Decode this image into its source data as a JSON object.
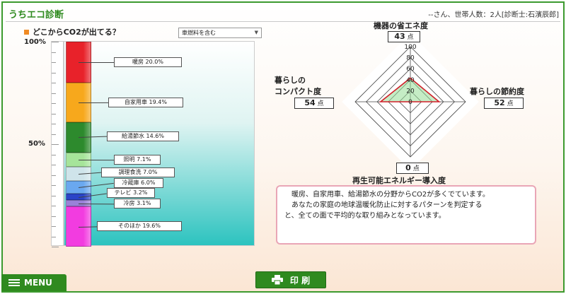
{
  "app": {
    "title": "うちエコ診断",
    "user_info": "--さん、世帯人数：2人[診断士:石濱辰郎]"
  },
  "co2_section": {
    "title": "どこからCO2が出てる？",
    "select_value": "車燃料を含む",
    "axis_labels": [
      "100%",
      "50%"
    ]
  },
  "chart_data": [
    {
      "type": "bar",
      "stacked": true,
      "title": "どこからCO2が出てる？",
      "categories": [
        "暖房",
        "自家用車",
        "給湯節水",
        "照明",
        "調理食洗",
        "冷蔵庫",
        "テレビ",
        "冷房",
        "そのほか"
      ],
      "values": [
        20.0,
        19.4,
        14.6,
        7.1,
        7.0,
        6.0,
        3.2,
        3.1,
        19.6
      ],
      "labels": [
        "暖房 20.0%",
        "自家用車 19.4%",
        "給湯節水 14.6%",
        "照明 7.1%",
        "調理食洗 7.0%",
        "冷蔵庫 6.0%",
        "テレビ 3.2%",
        "冷房 3.1%",
        "そのほか 19.6%"
      ],
      "colors": [
        "#e8222a",
        "#f7a81c",
        "#2d8a2d",
        "#a6e49a",
        "#cfe4ea",
        "#6aa8ef",
        "#2a44c8",
        "#9a82d8",
        "#f23ce0"
      ],
      "ylim": [
        0,
        100
      ],
      "y_tick_labels": [
        "100%",
        "50%"
      ]
    },
    {
      "type": "radar",
      "axes": [
        "機器の省エネ度",
        "暮らしの節約度",
        "再生可能エネルギー導入度",
        "暮らしのコンパクト度"
      ],
      "values": [
        43,
        52,
        0,
        54
      ],
      "ticks": [
        0,
        20,
        40,
        60,
        80,
        100
      ],
      "tick_labels": [
        "0",
        "20",
        "40",
        "60",
        "80",
        "100"
      ],
      "rlim": [
        0,
        100
      ]
    }
  ],
  "scores": {
    "unit": "点",
    "top": {
      "title": "機器の省エネ度",
      "value": "43"
    },
    "right": {
      "title": "暮らしの節約度",
      "value": "52"
    },
    "bottom": {
      "title": "再生可能エネルギー導入度",
      "value": "0"
    },
    "left": {
      "title_line1": "暮らしの",
      "title_line2": "コンパクト度",
      "value": "54"
    }
  },
  "message": {
    "line1": "暖房、自家用車、給湯節水の分野からCO2が多くでています。",
    "line2": "あなたの家庭の地球温暖化防止に対するパターンを判定する",
    "line3": "と、全ての面で平均的な取り組みとなっています。"
  },
  "buttons": {
    "menu": "MENU",
    "print": "印 刷"
  }
}
